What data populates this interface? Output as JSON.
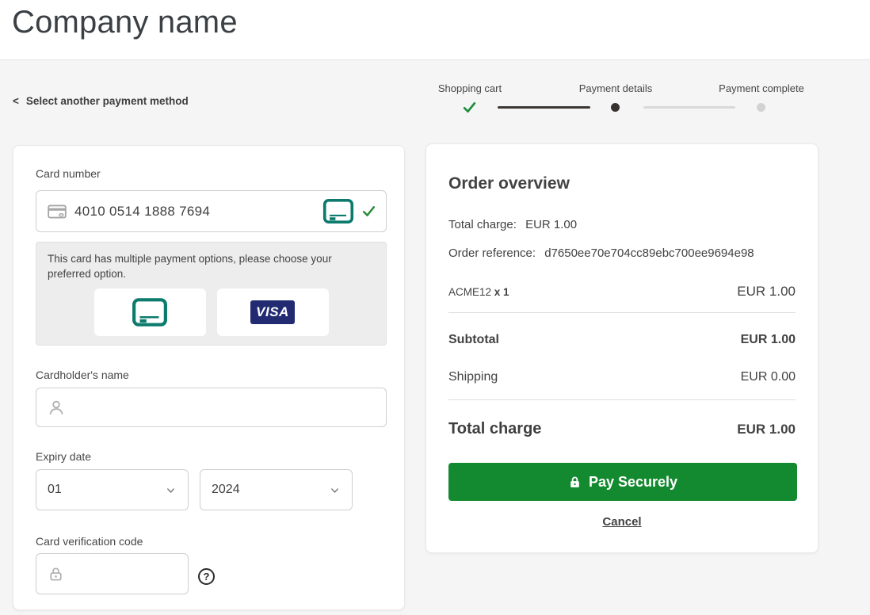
{
  "header": {
    "title": "Company name"
  },
  "back": {
    "chevron": "<",
    "label": "Select another payment method"
  },
  "stepper": {
    "steps": [
      {
        "label": "Shopping cart",
        "state": "complete"
      },
      {
        "label": "Payment details",
        "state": "current"
      },
      {
        "label": "Payment complete",
        "state": "upcoming"
      }
    ]
  },
  "card_form": {
    "card_number": {
      "label": "Card number",
      "value": "4010 0514 1888 7694"
    },
    "options_notice": "This card has multiple payment options, please choose your preferred option.",
    "brand_options": [
      {
        "name": "generic-card"
      },
      {
        "name": "visa",
        "label": "VISA"
      }
    ],
    "cardholder": {
      "label": "Cardholder's name",
      "value": ""
    },
    "expiry": {
      "label": "Expiry date",
      "month": "01",
      "year": "2024"
    },
    "cvc": {
      "label": "Card verification code",
      "value": "",
      "help_glyph": "?"
    }
  },
  "order": {
    "title": "Order overview",
    "total_charge_line": {
      "label": "Total charge:",
      "value": "EUR 1.00"
    },
    "reference_line": {
      "label": "Order reference:",
      "value": "d7650ee70e704cc89ebc700ee9694e98"
    },
    "items": [
      {
        "name": "ACME12",
        "qty": "x 1",
        "amount": "EUR 1.00"
      }
    ],
    "subtotal": {
      "label": "Subtotal",
      "amount": "EUR 1.00"
    },
    "shipping": {
      "label": "Shipping",
      "amount": "EUR 0.00"
    },
    "total": {
      "label": "Total charge",
      "amount": "EUR 1.00"
    },
    "pay_button_label": "Pay Securely",
    "cancel_label": "Cancel"
  },
  "colors": {
    "accent_teal": "#0C7B6E",
    "pay_green": "#148A30",
    "check_green": "#1E8E3E",
    "visa_navy": "#222A72",
    "stepper_done": "#3C3733",
    "stepper_todo": "#D9D9D9",
    "background": "#F5F5F5"
  }
}
